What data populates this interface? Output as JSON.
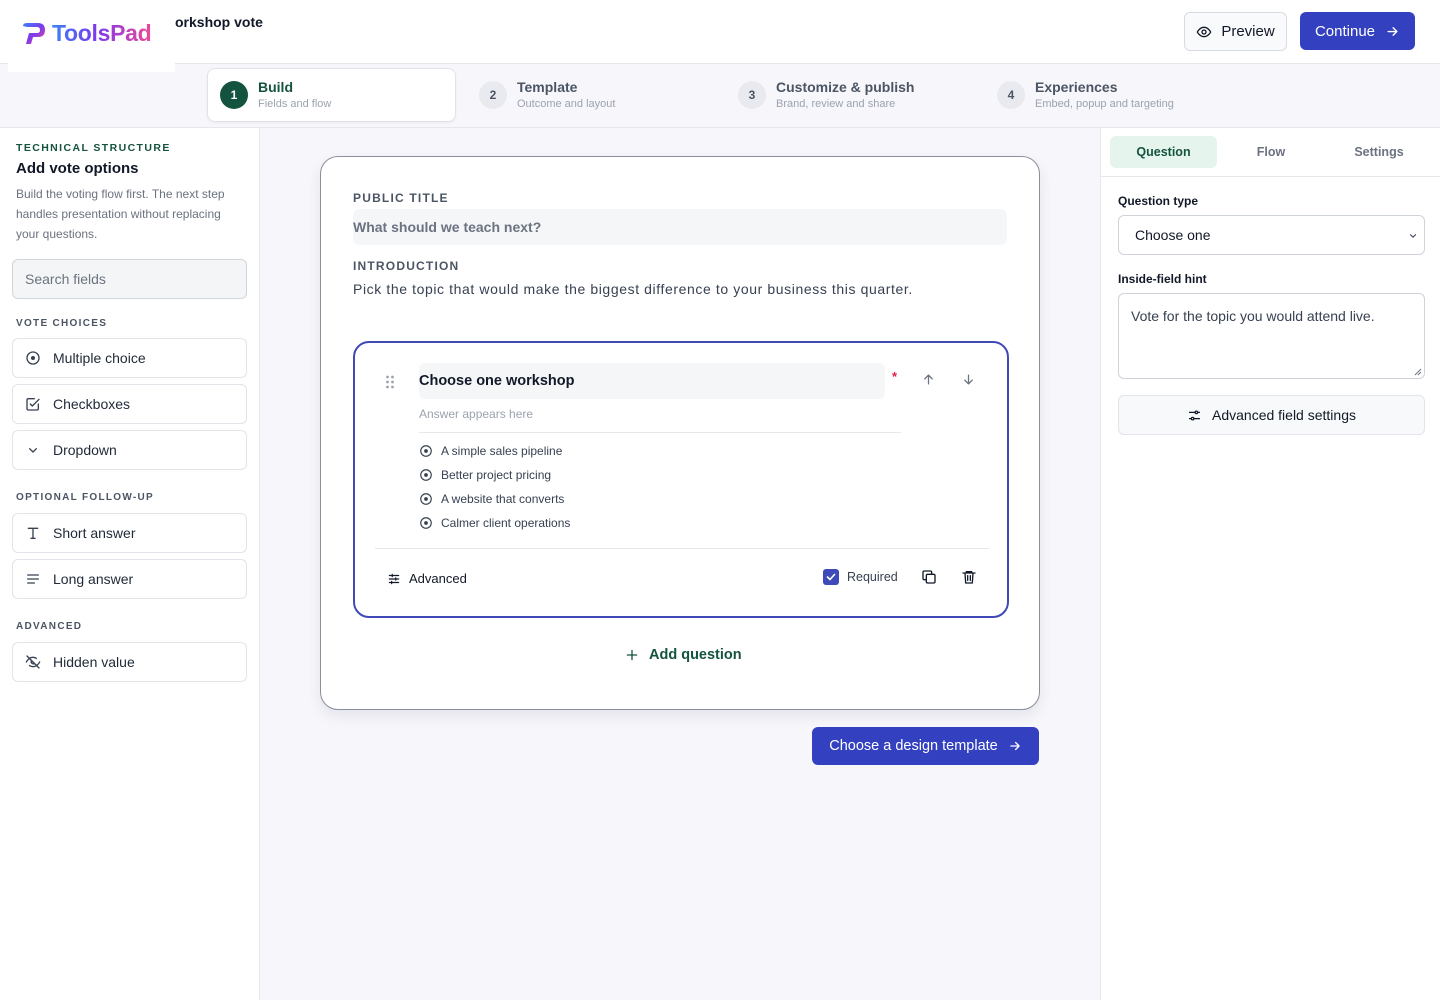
{
  "header": {
    "logo_text": "ToolsPad",
    "doc_title": "orkshop vote",
    "preview_label": "Preview",
    "continue_label": "Continue"
  },
  "steps": [
    {
      "num": "1",
      "title": "Build",
      "sub": "Fields and flow",
      "active": true
    },
    {
      "num": "2",
      "title": "Template",
      "sub": "Outcome and layout",
      "active": false
    },
    {
      "num": "3",
      "title": "Customize & publish",
      "sub": "Brand, review and share",
      "active": false
    },
    {
      "num": "4",
      "title": "Experiences",
      "sub": "Embed, popup and targeting",
      "active": false
    }
  ],
  "sidebar": {
    "eyebrow": "TECHNICAL STRUCTURE",
    "heading": "Add vote options",
    "description": "Build the voting flow first. The next step handles presentation without replacing your questions.",
    "search_placeholder": "Search fields",
    "group_vote": "VOTE CHOICES",
    "group_follow": "OPTIONAL FOLLOW-UP",
    "group_advanced": "ADVANCED",
    "items": [
      {
        "label": "Multiple choice",
        "icon": "radio-icon"
      },
      {
        "label": "Checkboxes",
        "icon": "checkbox-icon"
      },
      {
        "label": "Dropdown",
        "icon": "chevron-down-icon"
      },
      {
        "label": "Short answer",
        "icon": "text-icon"
      },
      {
        "label": "Long answer",
        "icon": "paragraph-icon"
      },
      {
        "label": "Hidden value",
        "icon": "eye-off-icon"
      }
    ]
  },
  "form": {
    "public_title_label": "PUBLIC TITLE",
    "public_title_value": "What should we teach next?",
    "intro_label": "INTRODUCTION",
    "intro_value": "Pick the topic that would make the biggest difference to your business this quarter.",
    "question": {
      "title": "Choose one workshop",
      "required_mark": "*",
      "hint": "Answer appears here",
      "options": [
        "A simple sales pipeline",
        "Better project pricing",
        "A website that converts",
        "Calmer client operations"
      ],
      "advanced_label": "Advanced",
      "required_label": "Required",
      "required": true
    },
    "add_question_label": "Add question",
    "next_label": "Choose a design template"
  },
  "right_panel": {
    "tabs": [
      "Question",
      "Flow",
      "Settings"
    ],
    "active_tab": "Question",
    "question_type_label": "Question type",
    "question_type_value": "Choose one",
    "hint_label": "Inside-field hint",
    "hint_value": "Vote for the topic you would attend live.",
    "advanced_settings_label": "Advanced field settings"
  },
  "colors": {
    "primary": "#3340c0",
    "brand_green": "#14533f",
    "active_tab_bg": "#e6f4ee",
    "required_star": "#e11d48"
  }
}
